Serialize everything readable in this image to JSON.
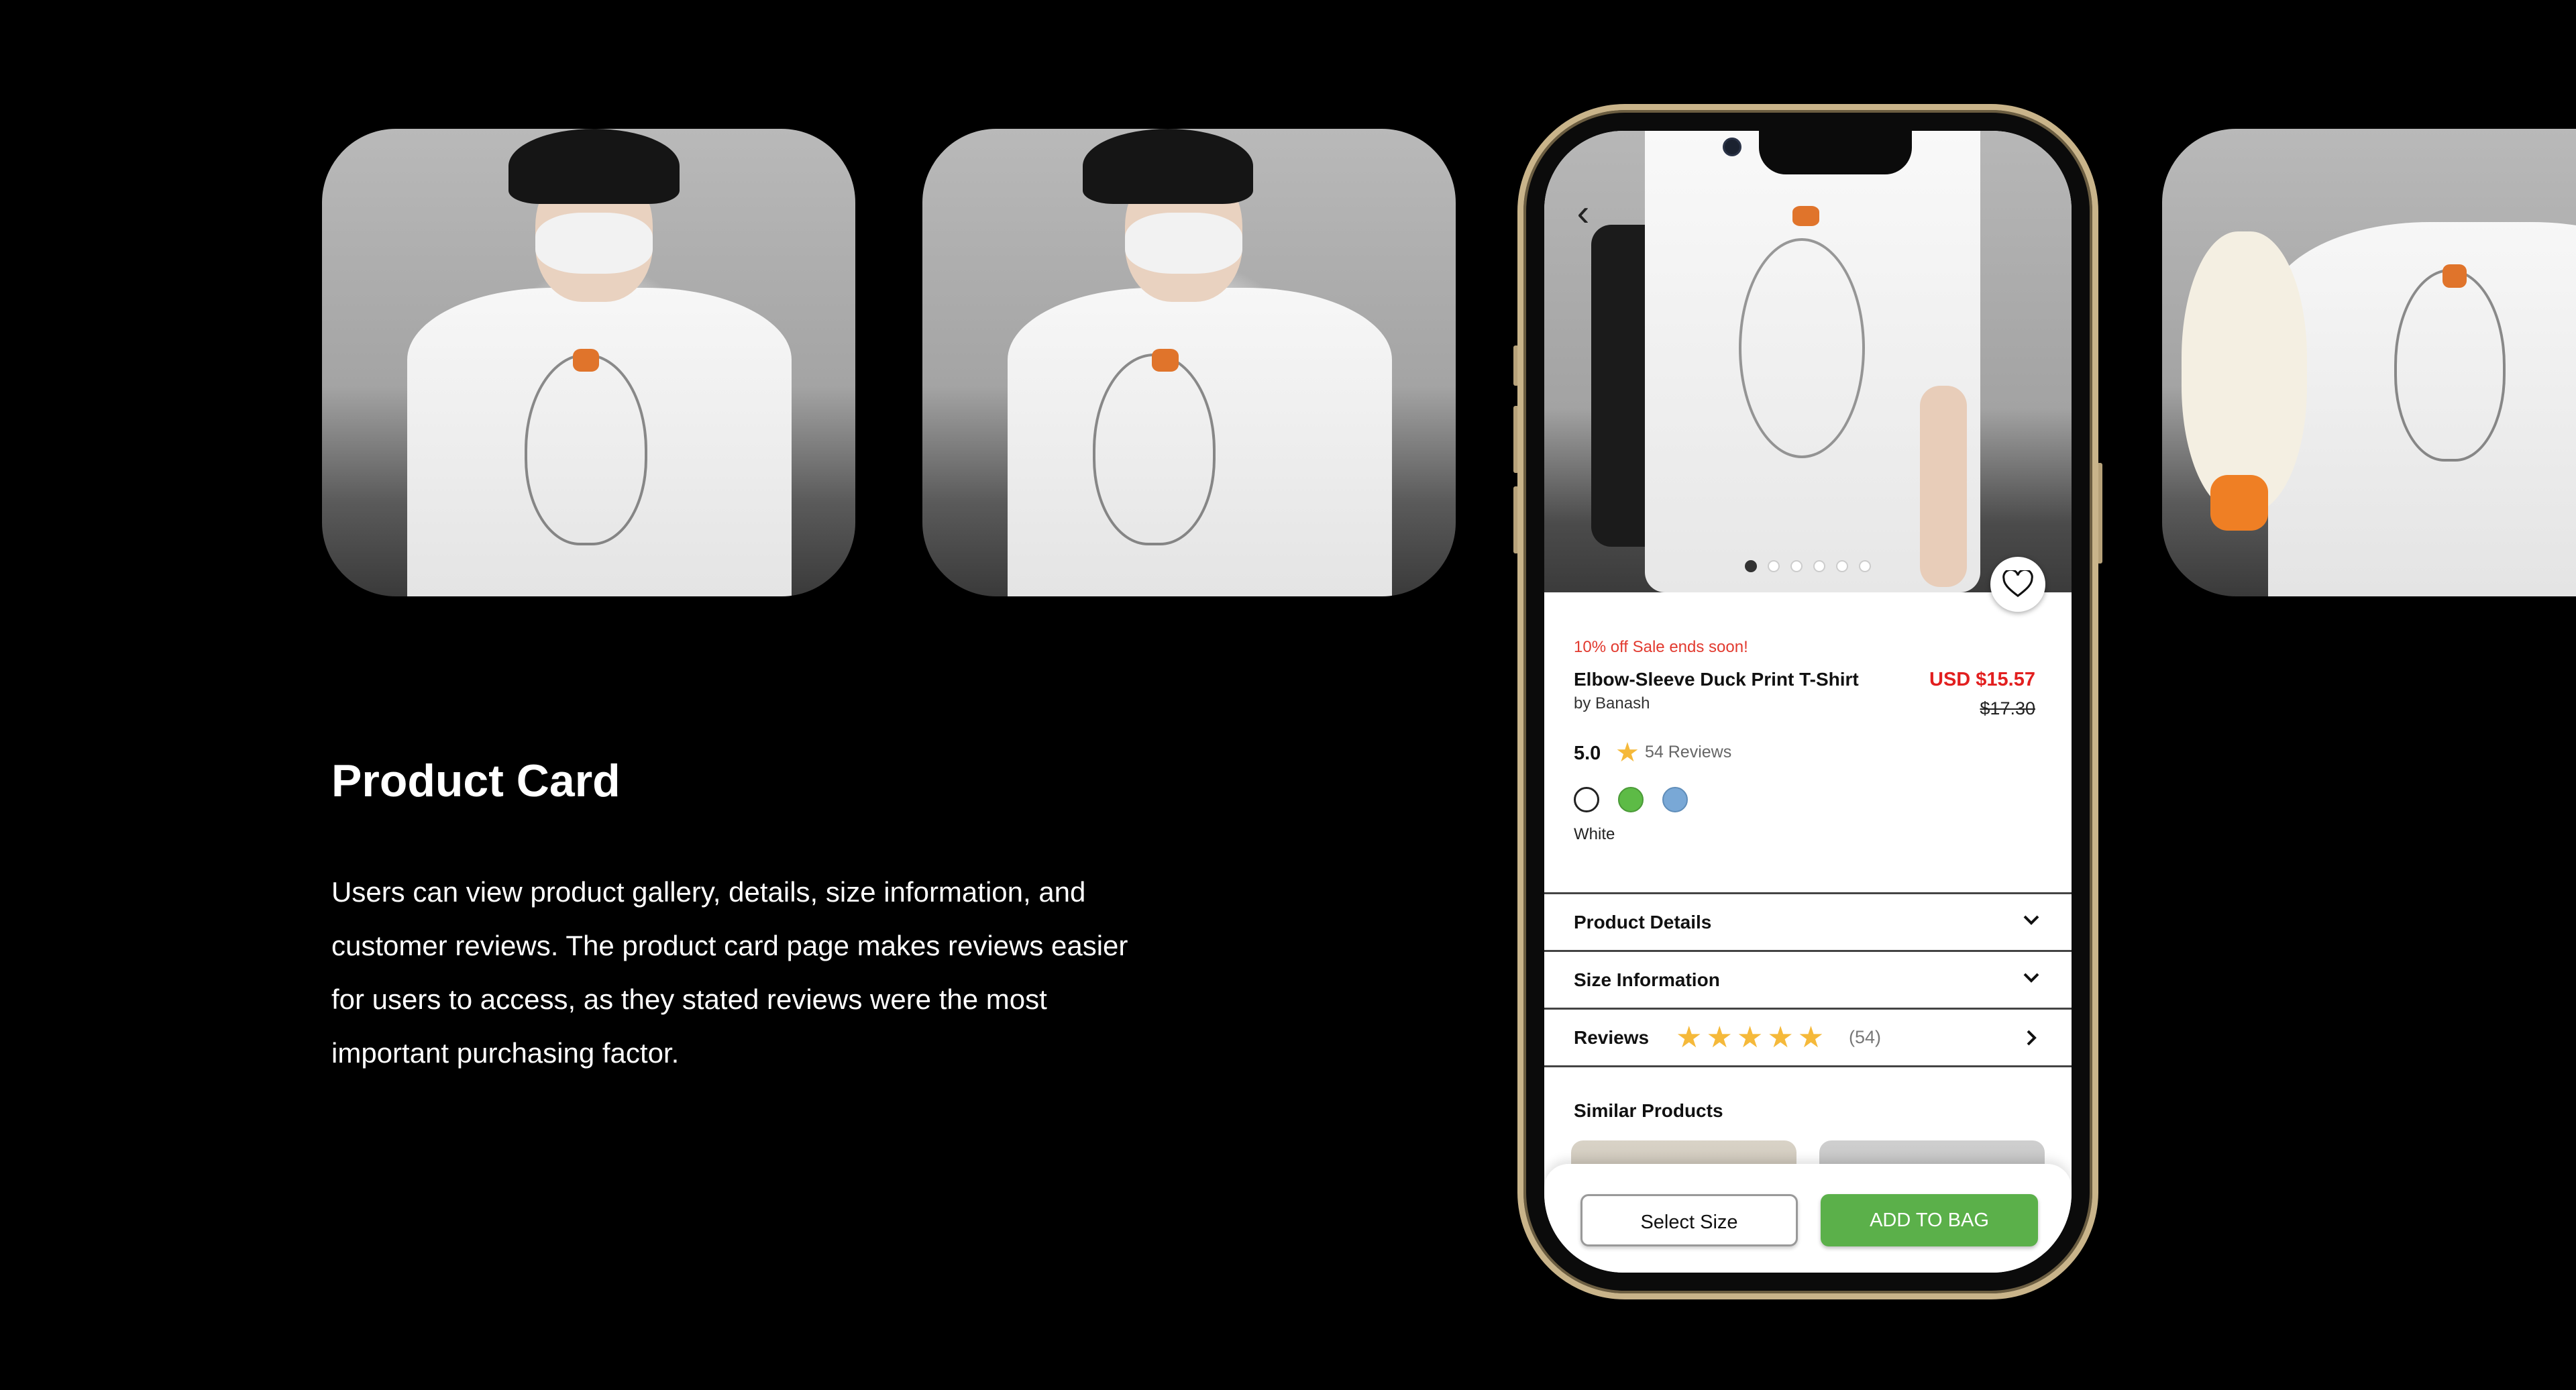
{
  "section": {
    "title": "Product Card",
    "description": "Users can view product gallery, details, size information, and customer reviews. The product card page makes reviews easier for users to access, as they stated reviews were the most important purchasing factor."
  },
  "product": {
    "sale_text": "10% off Sale ends soon!",
    "name": "Elbow-Sleeve Duck Print T-Shirt",
    "brand": "by Banash",
    "price": "USD $15.57",
    "original_price": "$17.30",
    "rating": "5.0",
    "review_count_text": "54 Reviews",
    "selected_color": "White",
    "colors": [
      "#ffffff",
      "#5dbb46",
      "#79a8d6"
    ],
    "carousel": {
      "total": 6,
      "active": 1
    }
  },
  "accordion": {
    "details_label": "Product Details",
    "size_label": "Size Information",
    "reviews_label": "Reviews",
    "reviews_stars": "★★★★★",
    "reviews_count": "(54)"
  },
  "similar": {
    "title": "Similar Products"
  },
  "actions": {
    "select_size": "Select Size",
    "add_to_bag": "ADD TO BAG"
  },
  "theme": {
    "accent_green": "#5bb04a",
    "sale_red": "#e23a2f",
    "star_gold": "#f5b93a",
    "phone_frame": "#c9b48a"
  }
}
